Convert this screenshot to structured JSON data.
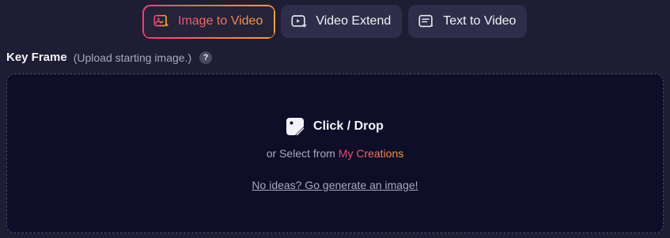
{
  "tabs": [
    {
      "label": "Image to Video",
      "icon": "image-sparkle-icon",
      "active": true
    },
    {
      "label": "Video Extend",
      "icon": "video-plus-icon",
      "active": false
    },
    {
      "label": "Text to Video",
      "icon": "text-doc-icon",
      "active": false
    }
  ],
  "key_frame": {
    "title": "Key Frame",
    "hint": "(Upload starting image.)",
    "help": "?"
  },
  "dropzone": {
    "icon": "image-upload-icon",
    "title": "Click / Drop",
    "select_prefix": "or Select from",
    "select_link": "My Creations",
    "generate_link": "No ideas? Go generate an image!"
  },
  "colors": {
    "background": "#1e1d33",
    "dropzone_bg": "#0f0e29",
    "accent_start": "#e8407d",
    "accent_end": "#f5a23c",
    "tab_bg": "#2f2e4a"
  }
}
